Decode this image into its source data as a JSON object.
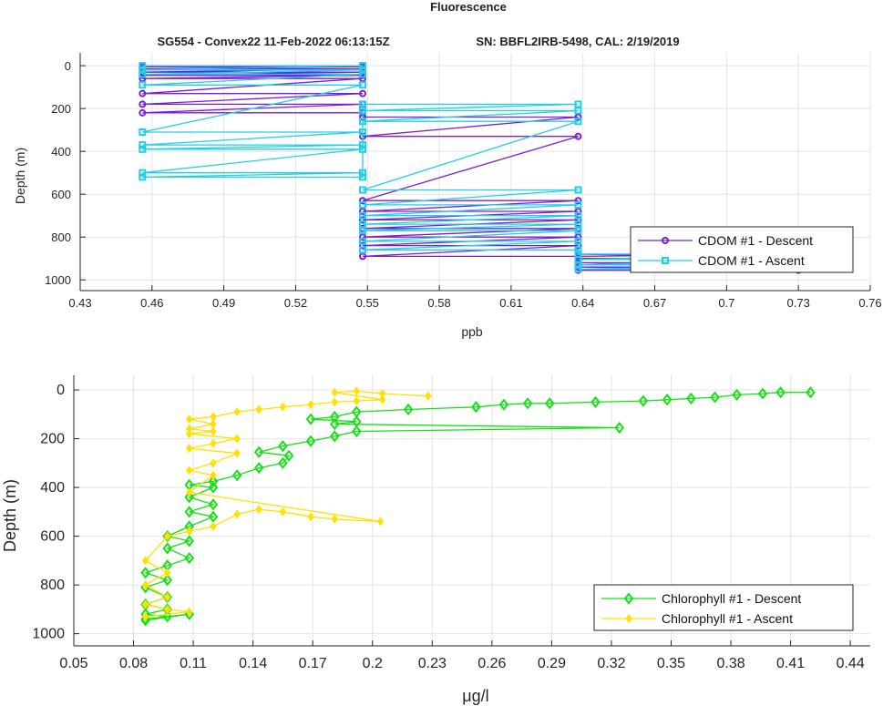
{
  "figure": {
    "title": "Fluorescence",
    "subtitle_left": "SG554 - Convex22 11-Feb-2022 06:13:15Z",
    "subtitle_right": "SN: BBFL2IRB-5498, CAL: 2/19/2019"
  },
  "colors": {
    "cdom_descent": "#7a1fd6",
    "cdom_ascent": "#22cfe6",
    "chl_descent": "#18e018",
    "chl_ascent": "#ffe000",
    "axis": "#262626",
    "grid": "#e4e4e4"
  },
  "chart_data": [
    {
      "type": "line",
      "title": "",
      "xlabel": "ppb",
      "ylabel": "Depth (m)",
      "xlim": [
        0.43,
        0.76
      ],
      "ylim": [
        1050,
        -60
      ],
      "y_reversed": true,
      "xticks": [
        "0.43",
        "0.46",
        "0.49",
        "0.52",
        "0.55",
        "0.58",
        "0.61",
        "0.64",
        "0.67",
        "0.7",
        "0.73",
        "0.76"
      ],
      "yticks": [
        "0",
        "200",
        "400",
        "600",
        "800",
        "1000"
      ],
      "legend_position": "bottom-right",
      "series": [
        {
          "name": "CDOM #1 - Descent",
          "marker": "circle",
          "x": [
            0.456,
            0.548,
            0.456,
            0.548,
            0.456,
            0.548,
            0.456,
            0.548,
            0.456,
            0.548,
            0.456,
            0.548,
            0.456,
            0.548,
            0.456,
            0.548,
            0.548,
            0.638,
            0.548,
            0.638,
            0.548,
            0.638,
            0.548,
            0.638,
            0.548,
            0.638,
            0.548,
            0.638,
            0.548,
            0.638,
            0.548,
            0.638,
            0.548,
            0.638,
            0.73,
            0.638,
            0.73,
            0.638,
            0.73,
            0.638,
            0.73,
            0.638,
            0.73,
            0.638
          ],
          "y": [
            5,
            5,
            15,
            15,
            30,
            30,
            45,
            45,
            60,
            60,
            130,
            130,
            180,
            180,
            220,
            220,
            240,
            240,
            330,
            330,
            630,
            630,
            680,
            680,
            720,
            720,
            760,
            760,
            800,
            800,
            840,
            840,
            890,
            890,
            880,
            880,
            900,
            900,
            920,
            920,
            940,
            940,
            955,
            955
          ]
        },
        {
          "name": "CDOM #1 - Ascent",
          "marker": "square",
          "x": [
            0.456,
            0.548,
            0.456,
            0.548,
            0.456,
            0.548,
            0.456,
            0.548,
            0.456,
            0.548,
            0.456,
            0.548,
            0.456,
            0.548,
            0.456,
            0.548,
            0.456,
            0.548,
            0.548,
            0.638,
            0.548,
            0.638,
            0.548,
            0.638,
            0.548,
            0.638,
            0.548,
            0.638,
            0.548,
            0.638,
            0.548,
            0.638,
            0.548,
            0.638,
            0.548,
            0.638,
            0.548,
            0.638,
            0.638,
            0.73,
            0.638,
            0.73,
            0.638,
            0.73,
            0.638,
            0.73
          ],
          "y": [
            0,
            0,
            20,
            20,
            40,
            40,
            90,
            90,
            310,
            310,
            370,
            370,
            390,
            390,
            500,
            500,
            520,
            520,
            180,
            180,
            210,
            210,
            260,
            260,
            580,
            580,
            650,
            650,
            700,
            700,
            740,
            740,
            770,
            770,
            820,
            820,
            860,
            860,
            880,
            880,
            905,
            905,
            930,
            930,
            950,
            950
          ]
        }
      ]
    },
    {
      "type": "line",
      "title": "",
      "xlabel": "μg/l",
      "ylabel": "Depth (m)",
      "xlim": [
        0.05,
        0.45
      ],
      "ylim": [
        1050,
        -60
      ],
      "y_reversed": true,
      "xticks": [
        "0.05",
        "0.08",
        "0.11",
        "0.14",
        "0.17",
        "0.2",
        "0.23",
        "0.26",
        "0.29",
        "0.32",
        "0.35",
        "0.38",
        "0.41",
        "0.44"
      ],
      "yticks": [
        "0",
        "200",
        "400",
        "600",
        "800",
        "1000"
      ],
      "legend_position": "bottom-right",
      "series": [
        {
          "name": "Chlorophyll #1 - Descent",
          "marker": "diamond",
          "x": [
            0.42,
            0.405,
            0.396,
            0.383,
            0.372,
            0.36,
            0.348,
            0.336,
            0.312,
            0.289,
            0.278,
            0.266,
            0.252,
            0.218,
            0.192,
            0.181,
            0.169,
            0.192,
            0.181,
            0.324,
            0.192,
            0.181,
            0.169,
            0.155,
            0.143,
            0.158,
            0.155,
            0.143,
            0.132,
            0.12,
            0.108,
            0.12,
            0.108,
            0.12,
            0.108,
            0.12,
            0.108,
            0.097,
            0.108,
            0.097,
            0.108,
            0.097,
            0.086,
            0.097,
            0.086,
            0.097,
            0.086,
            0.097,
            0.086,
            0.097,
            0.086,
            0.108,
            0.086
          ],
          "y": [
            10,
            10,
            15,
            20,
            30,
            35,
            40,
            45,
            50,
            55,
            55,
            60,
            70,
            80,
            90,
            110,
            120,
            130,
            140,
            155,
            170,
            190,
            210,
            230,
            255,
            270,
            300,
            320,
            350,
            375,
            390,
            400,
            440,
            470,
            500,
            520,
            560,
            600,
            620,
            650,
            690,
            720,
            750,
            780,
            810,
            850,
            880,
            900,
            920,
            930,
            940,
            920,
            945
          ]
        },
        {
          "name": "Chlorophyll #1 - Ascent",
          "marker": "diamond-filled",
          "x": [
            0.228,
            0.205,
            0.192,
            0.181,
            0.205,
            0.192,
            0.181,
            0.169,
            0.155,
            0.143,
            0.132,
            0.12,
            0.108,
            0.12,
            0.108,
            0.12,
            0.108,
            0.132,
            0.12,
            0.108,
            0.132,
            0.12,
            0.108,
            0.12,
            0.108,
            0.204,
            0.181,
            0.169,
            0.155,
            0.143,
            0.132,
            0.12,
            0.108,
            0.097,
            0.086,
            0.097,
            0.086,
            0.097,
            0.086,
            0.097,
            0.108,
            0.086
          ],
          "y": [
            25,
            15,
            5,
            10,
            40,
            45,
            50,
            60,
            70,
            80,
            90,
            110,
            120,
            140,
            160,
            170,
            180,
            200,
            220,
            240,
            260,
            300,
            330,
            350,
            420,
            540,
            530,
            520,
            500,
            490,
            510,
            560,
            580,
            600,
            700,
            750,
            800,
            850,
            880,
            900,
            910,
            930
          ]
        }
      ]
    }
  ]
}
